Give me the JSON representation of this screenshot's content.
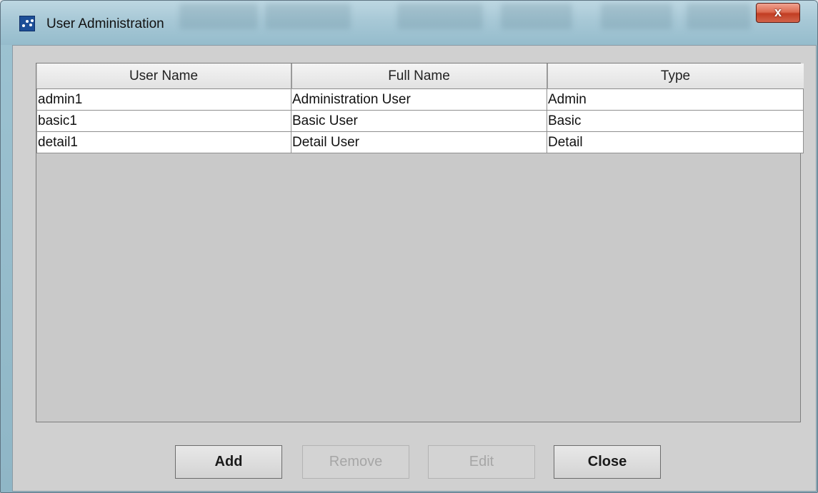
{
  "window": {
    "title": "User Administration",
    "close_glyph": "x"
  },
  "table": {
    "columns": [
      "User Name",
      "Full Name",
      "Type"
    ],
    "rows": [
      [
        "admin1",
        "Administration User",
        "Admin"
      ],
      [
        "basic1",
        "Basic User",
        "Basic"
      ],
      [
        "detail1",
        "Detail User",
        "Detail"
      ]
    ]
  },
  "buttons": {
    "add": "Add",
    "remove": "Remove",
    "edit": "Edit",
    "close": "Close"
  },
  "icons": {
    "app": "app-icon",
    "close": "close-icon"
  },
  "colors": {
    "title_bar": "#a7c8d6",
    "client_background": "#d0d0d0",
    "close_button": "#c23d22"
  }
}
